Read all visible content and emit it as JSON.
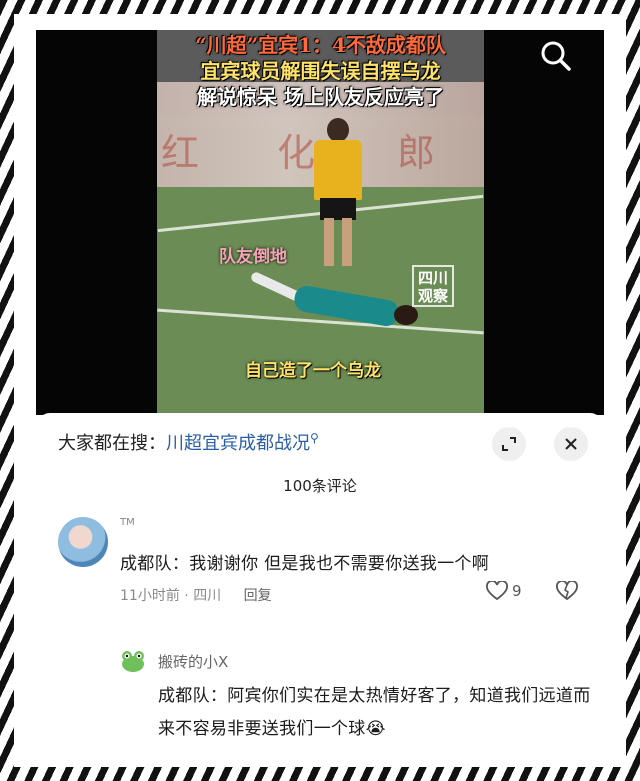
{
  "video": {
    "title_line1": "“川超”宜宾1：4不敌成都队",
    "title_line2": "宜宾球员解围失误自摆乌龙",
    "title_line3": "解说惊呆 场上队友反应亮了",
    "caption_teammate": "队友倒地",
    "caption_own_goal": "自己造了一个乌龙",
    "watermark": "四川\n观察",
    "search_icon": "search-icon"
  },
  "sheet": {
    "search_prefix": "大家都在搜：",
    "search_keyword": "川超宜宾成都战况",
    "comment_count": "100条评论",
    "expand_icon": "expand-icon",
    "close_icon": "close-icon"
  },
  "comments": [
    {
      "username": "TM",
      "text": "成都队：我谢谢你 但是我也不需要你送我一个啊",
      "time": "11小时前",
      "location": "四川",
      "reply_label": "回复",
      "likes": "9"
    },
    {
      "username": "搬砖的小X",
      "text": "成都队：阿宾你们实在是太热情好客了，知道我们远道而来不容易非要送我们一个球",
      "emoji": "😭"
    }
  ],
  "separator": " · "
}
